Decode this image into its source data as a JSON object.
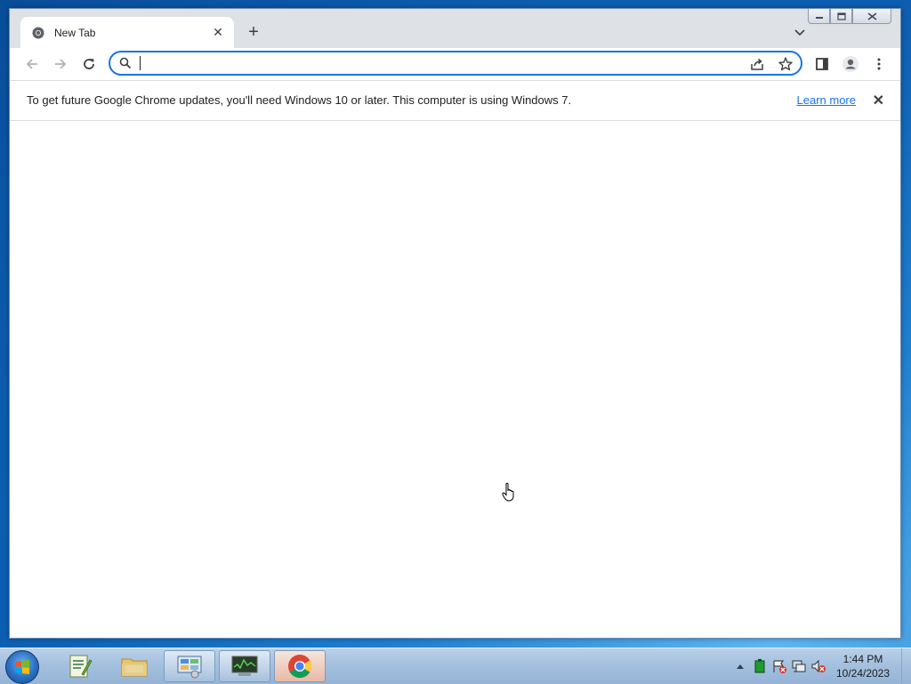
{
  "browser": {
    "tab": {
      "title": "New Tab",
      "close_glyph": "✕"
    },
    "new_tab_glyph": "+",
    "omnibox": {
      "value": "",
      "placeholder": ""
    },
    "infobar": {
      "message": "To get future Google Chrome updates, you'll need Windows 10 or later. This computer is using Windows 7.",
      "link": "Learn more",
      "close_glyph": "✕"
    },
    "icons": {
      "tab_favicon": "chrome-icon",
      "back": "back-arrow-icon",
      "forward": "forward-arrow-icon",
      "reload": "reload-icon",
      "search": "search-icon",
      "share": "share-icon",
      "bookmark": "star-icon",
      "side_panel": "side-panel-icon",
      "profile": "profile-icon",
      "menu": "kebab-menu-icon",
      "tab_search": "chevron-down-icon"
    },
    "accent_color": "#1a73e8"
  },
  "taskbar": {
    "apps": [
      {
        "name": "notepad-plus-plus",
        "icon": "notepad-icon"
      },
      {
        "name": "windows-explorer",
        "icon": "folder-icon"
      },
      {
        "name": "control-panel",
        "icon": "control-panel-icon"
      },
      {
        "name": "system-monitor",
        "icon": "monitor-icon"
      },
      {
        "name": "google-chrome",
        "icon": "chrome-icon",
        "active": true
      }
    ],
    "tray": {
      "icons": [
        "show-hidden-icons-icon",
        "battery-icon",
        "action-center-icon",
        "network-icon",
        "volume-muted-icon"
      ],
      "time": "1:44 PM",
      "date": "10/24/2023"
    }
  }
}
